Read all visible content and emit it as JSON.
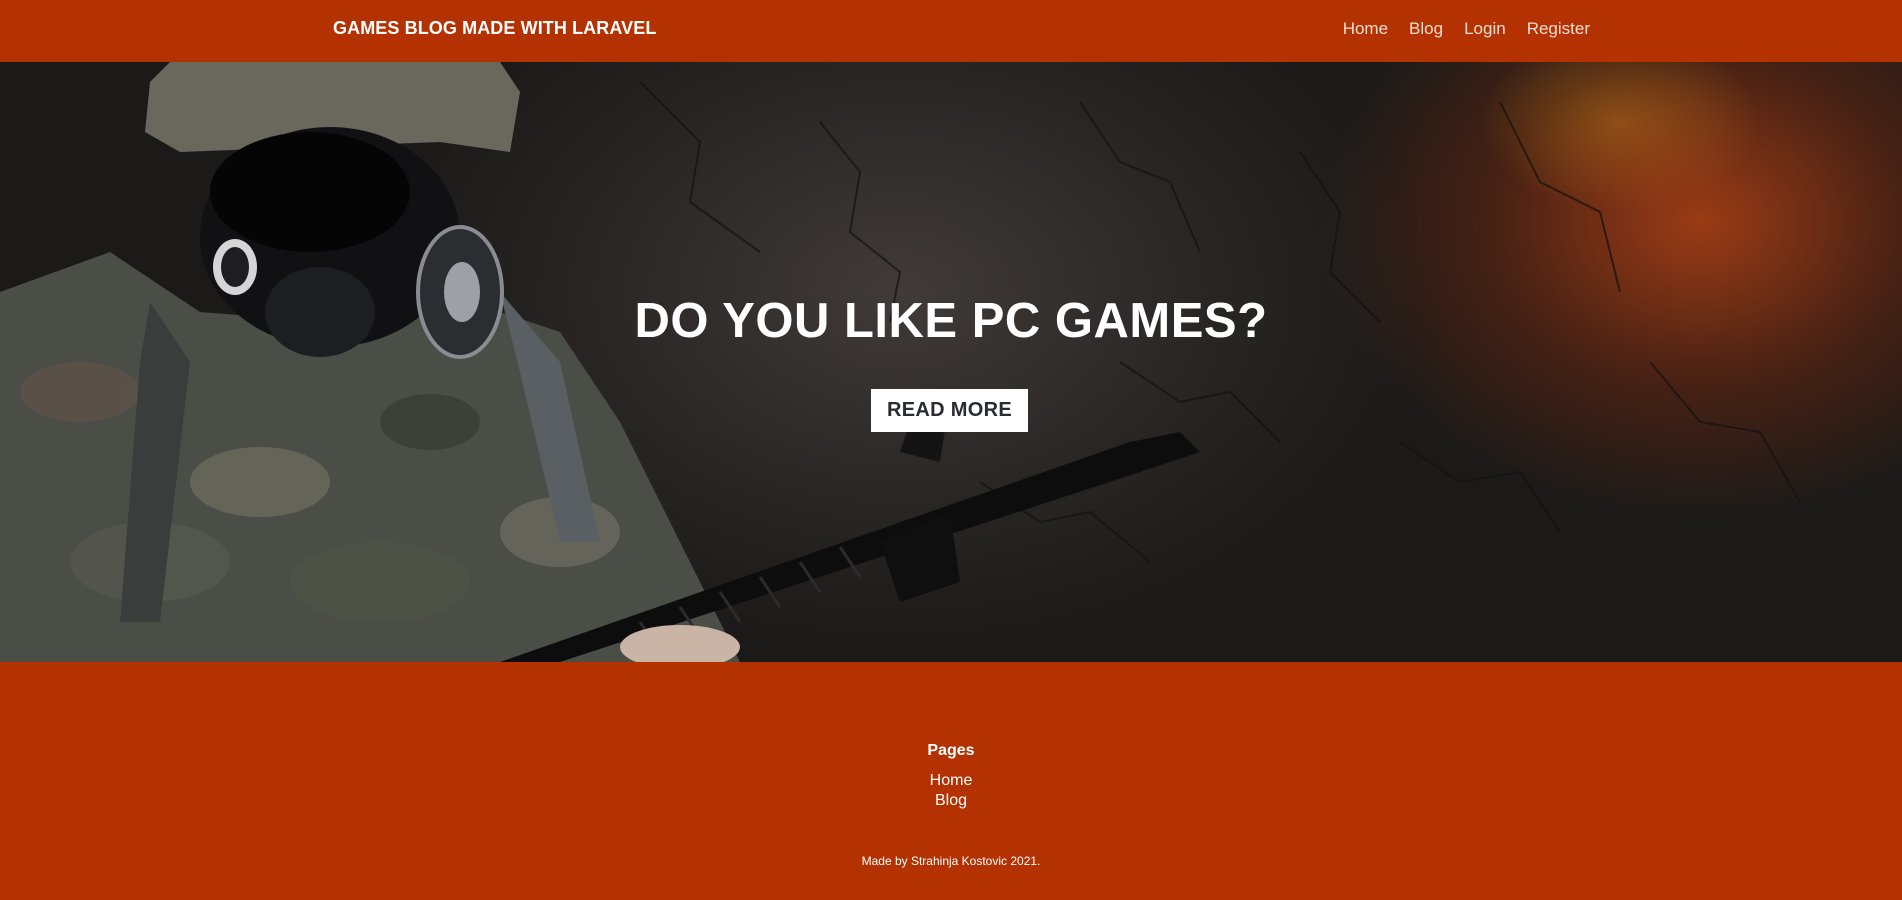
{
  "header": {
    "brand": "GAMES BLOG MADE WITH LARAVEL",
    "nav": [
      {
        "label": "Home"
      },
      {
        "label": "Blog"
      },
      {
        "label": "Login"
      },
      {
        "label": "Register"
      }
    ]
  },
  "hero": {
    "title": "DO YOU LIKE PC GAMES?",
    "button_label": "READ MORE"
  },
  "footer": {
    "heading": "Pages",
    "links": [
      {
        "label": "Home"
      },
      {
        "label": "Blog"
      }
    ],
    "credit": "Made by Strahinja Kostovic 2021."
  },
  "colors": {
    "brand": "#b43202",
    "hero_dark": "#2a2726",
    "button_bg": "#ffffff",
    "button_text": "#2b2b33"
  }
}
